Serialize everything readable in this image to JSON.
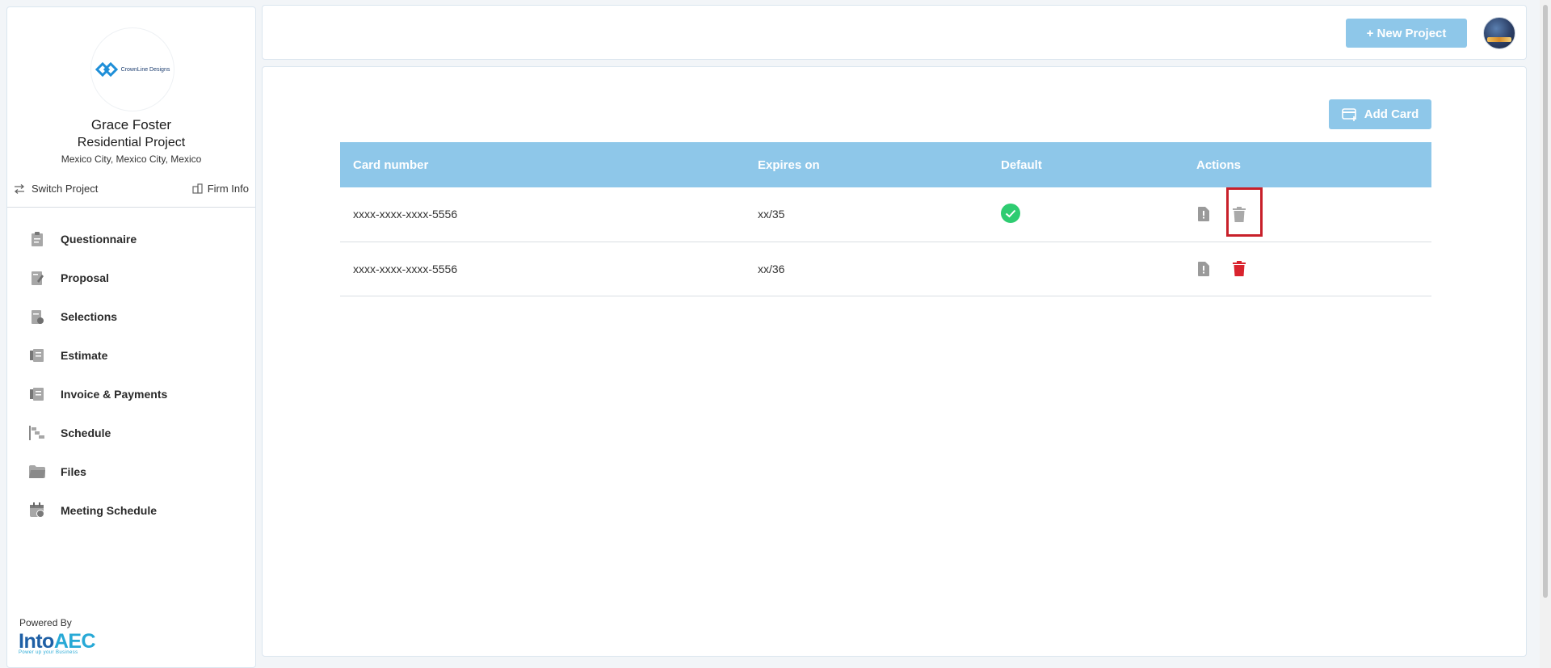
{
  "sidebar": {
    "logo_text": "CrownLine Designs",
    "client_name": "Grace Foster",
    "project_type": "Residential Project",
    "project_location": "Mexico City, Mexico City, Mexico",
    "switch_project_label": "Switch Project",
    "firm_info_label": "Firm Info",
    "items": [
      {
        "label": "Questionnaire",
        "icon": "clipboard-icon"
      },
      {
        "label": "Proposal",
        "icon": "proposal-icon"
      },
      {
        "label": "Selections",
        "icon": "selections-icon"
      },
      {
        "label": "Estimate",
        "icon": "estimate-icon"
      },
      {
        "label": "Invoice & Payments",
        "icon": "invoice-icon"
      },
      {
        "label": "Schedule",
        "icon": "schedule-icon"
      },
      {
        "label": "Files",
        "icon": "folder-icon"
      },
      {
        "label": "Meeting Schedule",
        "icon": "calendar-icon"
      }
    ],
    "powered_by": "Powered By",
    "brand_left": "Into",
    "brand_right": "AEC",
    "brand_tagline": "Power up your Business"
  },
  "header": {
    "new_project_label": "+ New Project"
  },
  "main": {
    "add_card_label": "Add Card",
    "table": {
      "headers": [
        "Card number",
        "Expires on",
        "Default",
        "Actions"
      ],
      "rows": [
        {
          "card_number": "xxxx-xxxx-xxxx-5556",
          "expires": "xx/35",
          "default": true
        },
        {
          "card_number": "xxxx-xxxx-xxxx-5556",
          "expires": "xx/36",
          "default": false
        }
      ]
    }
  },
  "colors": {
    "accent": "#8ec7e9",
    "success": "#2ecc71",
    "danger": "#d9232e",
    "muted_icon": "#9a9a9a"
  }
}
